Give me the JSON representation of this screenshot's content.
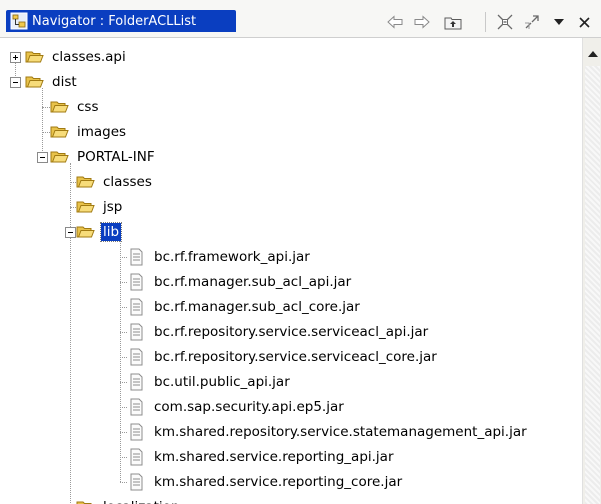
{
  "view": {
    "title": "Navigator : FolderACLList",
    "toolbar": {
      "back_icon": "back-arrow-icon",
      "forward_icon": "forward-arrow-icon",
      "up_icon": "up-folder-icon",
      "collapse_icon": "collapse-all-icon",
      "link_icon": "link-with-editor-icon",
      "menu_icon": "view-menu-icon",
      "close_icon": "close-icon"
    }
  },
  "colors": {
    "selection": "#0a3ec0",
    "folder": "#e8c24a",
    "folder_edge": "#a07a12"
  },
  "tree": {
    "rows": [
      {
        "label": "classes.api",
        "kind": "folder",
        "toggle": "plus"
      },
      {
        "label": "dist",
        "kind": "folder",
        "toggle": "minus"
      },
      {
        "label": "css",
        "kind": "folder"
      },
      {
        "label": "images",
        "kind": "folder"
      },
      {
        "label": "PORTAL-INF",
        "kind": "folder",
        "toggle": "minus"
      },
      {
        "label": "classes",
        "kind": "folder"
      },
      {
        "label": "jsp",
        "kind": "folder"
      },
      {
        "label": "lib",
        "kind": "folder",
        "toggle": "minus",
        "selected": true
      },
      {
        "label": "bc.rf.framework_api.jar",
        "kind": "file"
      },
      {
        "label": "bc.rf.manager.sub_acl_api.jar",
        "kind": "file"
      },
      {
        "label": "bc.rf.manager.sub_acl_core.jar",
        "kind": "file"
      },
      {
        "label": "bc.rf.repository.service.serviceacl_api.jar",
        "kind": "file"
      },
      {
        "label": "bc.rf.repository.service.serviceacl_core.jar",
        "kind": "file"
      },
      {
        "label": "bc.util.public_api.jar",
        "kind": "file"
      },
      {
        "label": "com.sap.security.api.ep5.jar",
        "kind": "file"
      },
      {
        "label": "km.shared.repository.service.statemanagement_api.jar",
        "kind": "file"
      },
      {
        "label": "km.shared.service.reporting_api.jar",
        "kind": "file"
      },
      {
        "label": "km.shared.service.reporting_core.jar",
        "kind": "file"
      },
      {
        "label": "localization",
        "kind": "folder"
      }
    ]
  }
}
